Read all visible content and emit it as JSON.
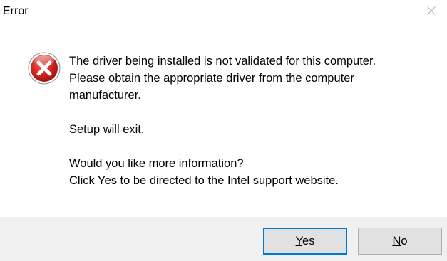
{
  "window": {
    "title": "Error"
  },
  "titlebar": {
    "close_icon": "close-icon"
  },
  "icon": {
    "name": "error-icon",
    "color": "#c8201e"
  },
  "message": {
    "lines": [
      "The driver being installed is not validated for this computer.",
      "Please obtain the appropriate driver from the computer",
      "manufacturer.",
      "",
      "Setup will exit.",
      "",
      "Would you like more information?",
      "Click Yes to be directed to the Intel support website."
    ]
  },
  "buttons": {
    "yes": {
      "mnemonic": "Y",
      "rest": "es"
    },
    "no": {
      "mnemonic": "N",
      "rest": "o"
    }
  },
  "colors": {
    "footer_bg": "#f0f0f0",
    "focus_border": "#0078d7",
    "button_bg": "#e1e1e1"
  }
}
